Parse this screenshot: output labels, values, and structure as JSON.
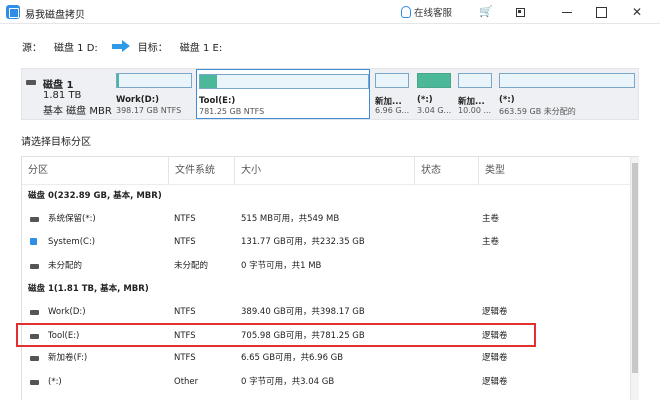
{
  "window": {
    "title": "易我磁盘拷贝",
    "support_label": "在线客服",
    "icons": [
      "cart-icon",
      "restore-icon",
      "minimize-icon",
      "maximize-icon",
      "close-icon"
    ]
  },
  "route": {
    "source_label": "源：",
    "source_value": "磁盘 1 D:",
    "target_label": "目标：",
    "target_value": "磁盘 1 E:"
  },
  "disk_map": {
    "name": "磁盘 1",
    "size": "1.81 TB",
    "type": "基本 磁盘 MBR",
    "partitions": [
      {
        "label": "Work(D:)",
        "info": "398.17 GB NTFS",
        "used": 0.02,
        "selected": false
      },
      {
        "label": "Tool(E:)",
        "info": "781.25 GB NTFS",
        "used": 0.1,
        "selected": true
      },
      {
        "label": "新加...",
        "info": "6.96 G...",
        "used": 0.0,
        "selected": false
      },
      {
        "label": "(*:)",
        "info": "3.04 G...",
        "used": 1.0,
        "selected": false
      },
      {
        "label": "新加...",
        "info": "10.00 ...",
        "used": 0.0,
        "selected": false
      },
      {
        "label": "(*:)",
        "info": "663.59 GB 未分配的",
        "used": 0.0,
        "selected": false
      }
    ]
  },
  "section_label": "请选择目标分区",
  "table": {
    "headers": [
      "分区",
      "文件系统",
      "大小",
      "状态",
      "类型"
    ],
    "rows": [
      {
        "kind": "group",
        "name": "磁盘 0(232.89 GB, 基本, MBR)"
      },
      {
        "kind": "item",
        "name": "系统保留(*:)",
        "fs": "NTFS",
        "size": "515 MB可用，共549 MB",
        "status": "",
        "type": "主卷",
        "icon": "disk"
      },
      {
        "kind": "item",
        "name": "System(C:)",
        "fs": "NTFS",
        "size": "131.77 GB可用，共232.35 GB",
        "status": "",
        "type": "主卷",
        "icon": "sys"
      },
      {
        "kind": "item",
        "name": "未分配的",
        "fs": "未分配的",
        "size": "0 字节可用，共1 MB",
        "status": "",
        "type": "",
        "icon": "disk"
      },
      {
        "kind": "group",
        "name": "磁盘 1(1.81 TB, 基本, MBR)"
      },
      {
        "kind": "item",
        "name": "Work(D:)",
        "fs": "NTFS",
        "size": "389.40 GB可用，共398.17 GB",
        "status": "",
        "type": "逻辑卷",
        "icon": "disk"
      },
      {
        "kind": "item",
        "name": "Tool(E:)",
        "fs": "NTFS",
        "size": "705.98 GB可用，共781.25 GB",
        "status": "",
        "type": "逻辑卷",
        "icon": "disk",
        "selected": true
      },
      {
        "kind": "item",
        "name": "新加卷(F:)",
        "fs": "NTFS",
        "size": "6.65 GB可用，共6.96 GB",
        "status": "",
        "type": "逻辑卷",
        "icon": "disk"
      },
      {
        "kind": "item",
        "name": "(*:)",
        "fs": "Other",
        "size": "0 字节可用，共3.04 GB",
        "status": "",
        "type": "逻辑卷",
        "icon": "disk"
      }
    ]
  },
  "colors": {
    "accent": "#2e8de6",
    "used_fill": "#4bb89a",
    "selection": "#e03030"
  }
}
